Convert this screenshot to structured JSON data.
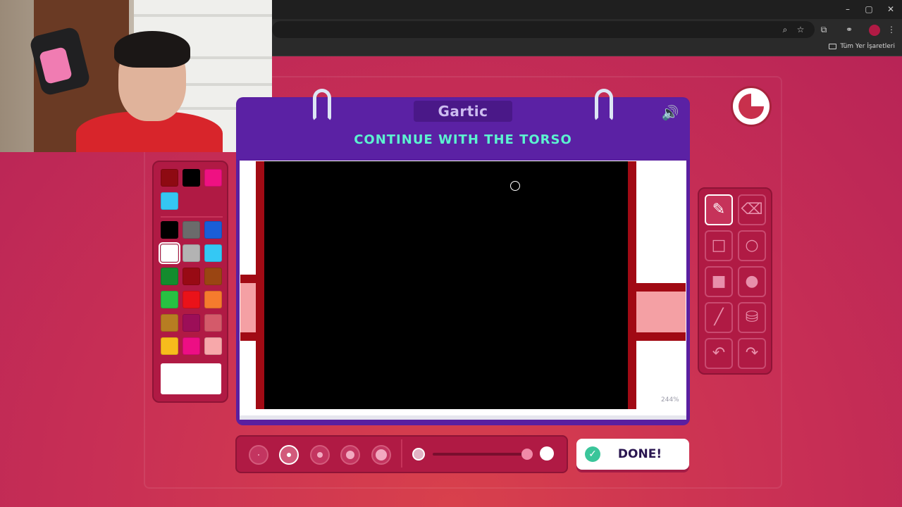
{
  "browser": {
    "bookmarks_label": "Tüm Yer İşaretleri",
    "window_controls": [
      "–",
      "▢",
      "✕"
    ]
  },
  "game": {
    "logo": "Gartic",
    "instruction": "CONTINUE WITH THE TORSO",
    "zoom_level": "244%",
    "done_label": "DONE!",
    "timer_remaining_fraction": 0.75
  },
  "palette": {
    "recent": [
      "#8e0a12",
      "#000000",
      "#ef1182",
      "#35c6f2"
    ],
    "colors": [
      "#000000",
      "#6b6b6b",
      "#1a5ed8",
      "#ffffff",
      "#b3b3b3",
      "#34c8f4",
      "#148b2d",
      "#980a14",
      "#9a4512",
      "#27c142",
      "#ea1219",
      "#f57b2d",
      "#b77d22",
      "#9c0e58",
      "#d45a6a",
      "#f7bc1c",
      "#ed0e84",
      "#f7a8aa"
    ],
    "selected_color": "#ffffff"
  },
  "tools": [
    "pencil-icon",
    "eraser-icon",
    "rectangle-outline-icon",
    "circle-outline-icon",
    "rectangle-filled-icon",
    "circle-filled-icon",
    "line-icon",
    "fill-bucket-icon",
    "undo-icon",
    "redo-icon"
  ],
  "brush": {
    "sizes": 5,
    "selected_size_index": 1,
    "opacity_level": 1.0
  }
}
